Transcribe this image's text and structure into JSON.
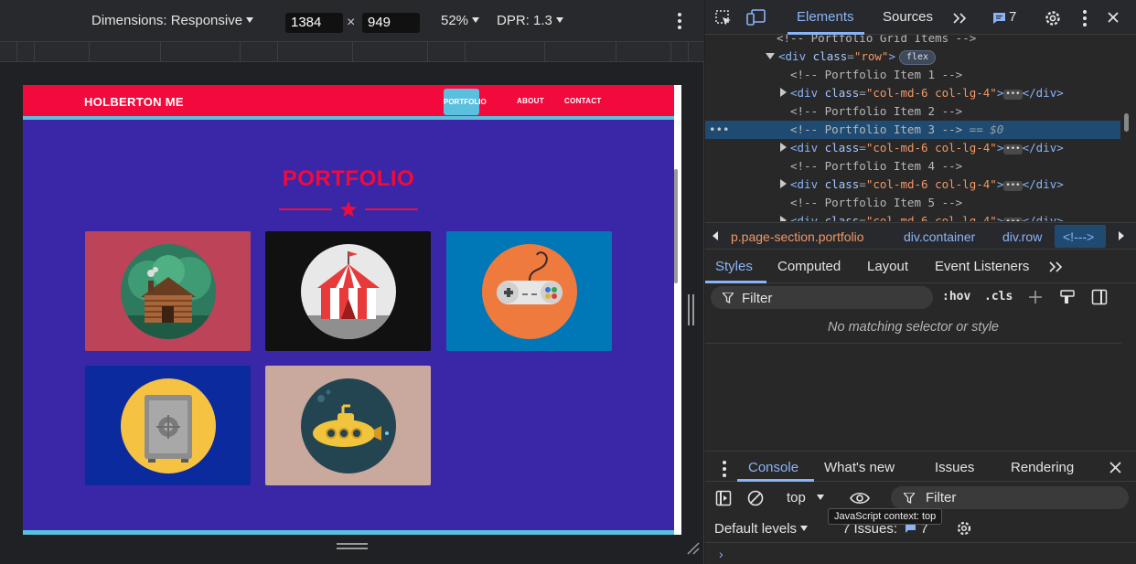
{
  "emulation": {
    "dimensions_label": "Dimensions: Responsive",
    "width": "1384",
    "height": "949",
    "times": "×",
    "zoom": "52%",
    "dpr": "DPR: 1.3"
  },
  "site": {
    "brand": "HOLBERTON ME",
    "nav": {
      "portfolio": "PORTFOLIO",
      "about": "ABOUT",
      "contact": "CONTACT"
    },
    "section_title": "PORTFOLIO",
    "colors": {
      "nav": "#f20a3c",
      "accent": "#5bc0de",
      "section_bg": "#3a27a7"
    },
    "items": [
      {
        "icon": "cabin-icon",
        "tile": "#bd4358",
        "circle": "#2d7a5f"
      },
      {
        "icon": "circus-tent-icon",
        "tile": "#111111",
        "circle": "#e8e8e8"
      },
      {
        "icon": "game-controller-icon",
        "tile": "#0077b6",
        "circle": "#ef7a3e"
      },
      {
        "icon": "safe-icon",
        "tile": "#0b2a9e",
        "circle": "#f5c242"
      },
      {
        "icon": "submarine-icon",
        "tile": "#c9a89e",
        "circle": "#234552"
      }
    ]
  },
  "devtools": {
    "tabs": {
      "elements": "Elements",
      "sources": "Sources",
      "issues_count": "7"
    },
    "dom": {
      "l0": "<!-- Portfolio Grid Items -->",
      "l1_tag": "<div ",
      "l1_attr": "class",
      "l1_val": "\"row\"",
      "l1_close": ">",
      "l1_badge": "flex",
      "c1": "<!-- Portfolio Item 1 -->",
      "c2": "<!-- Portfolio Item 2 -->",
      "c3": "<!-- Portfolio Item 3 -->",
      "c3_suffix": " == $0",
      "c4": "<!-- Portfolio Item 4 -->",
      "c5": "<!-- Portfolio Item 5 -->",
      "div_open": "<div ",
      "div_attr": "class",
      "div_val": "\"col-md-6 col-lg-4\"",
      "div_gt": ">",
      "ellipsis": "•••",
      "div_close": "</div>",
      "row_dots": "•••"
    },
    "breadcrumbs": [
      "p.page-section.portfolio",
      "div.container",
      "div.row",
      "<!--->"
    ],
    "styles_tabs": [
      "Styles",
      "Computed",
      "Layout",
      "Event Listeners"
    ],
    "filter_placeholder": "Filter",
    "hov": ":hov",
    "cls": ".cls",
    "no_match": "No matching selector or style",
    "drawer_tabs": [
      "Console",
      "What's new",
      "Issues",
      "Rendering"
    ],
    "context": "top",
    "console_filter": "Filter",
    "levels": "Default levels",
    "issues_inline": "7 Issues:",
    "issues_inline_count": "7",
    "tooltip": "JavaScript context: top",
    "prompt": "›"
  }
}
